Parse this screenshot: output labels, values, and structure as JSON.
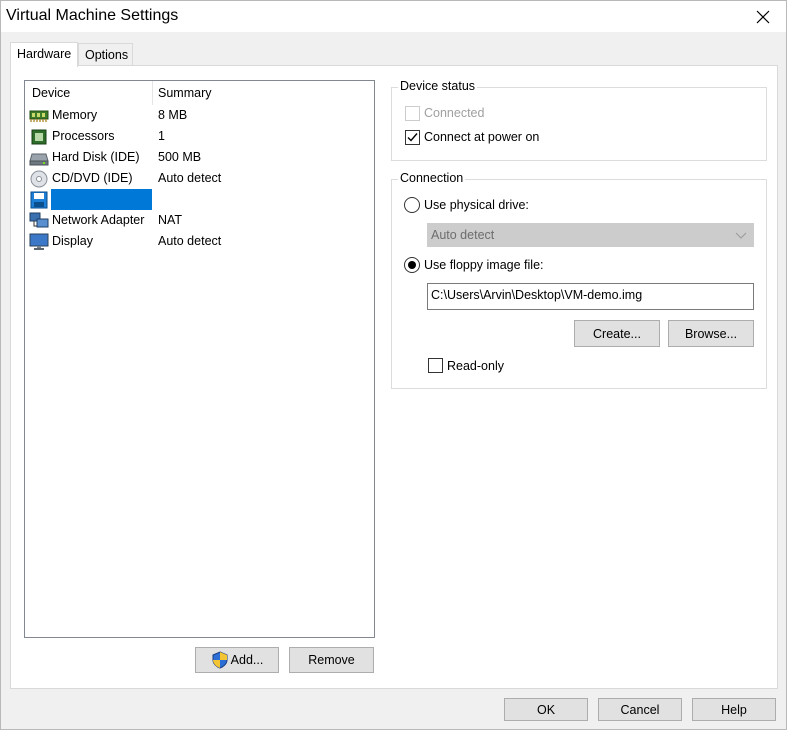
{
  "window": {
    "title": "Virtual Machine Settings"
  },
  "tabs": [
    {
      "label": "Hardware",
      "active": true
    },
    {
      "label": "Options",
      "active": false
    }
  ],
  "device_list": {
    "columns": [
      "Device",
      "Summary"
    ],
    "rows": [
      {
        "device": "Memory",
        "summary": "8 MB",
        "icon": "memory-icon",
        "selected": false
      },
      {
        "device": "Processors",
        "summary": "1",
        "icon": "processor-icon",
        "selected": false
      },
      {
        "device": "Hard Disk (IDE)",
        "summary": "500 MB",
        "icon": "hard-disk-icon",
        "selected": false
      },
      {
        "device": "CD/DVD (IDE)",
        "summary": "Auto detect",
        "icon": "cd-dvd-icon",
        "selected": false
      },
      {
        "device": "",
        "summary": "",
        "icon": "floppy-icon",
        "selected": true
      },
      {
        "device": "Network Adapter",
        "summary": "NAT",
        "icon": "network-adapter-icon",
        "selected": false
      },
      {
        "device": "Display",
        "summary": "Auto detect",
        "icon": "display-icon",
        "selected": false
      }
    ],
    "add_label": "Add...",
    "remove_label": "Remove"
  },
  "device_status": {
    "title": "Device status",
    "connected_label": "Connected",
    "connected_checked": false,
    "connected_enabled": false,
    "connect_power_on_label": "Connect at power on",
    "connect_power_on_checked": true
  },
  "connection": {
    "title": "Connection",
    "physical_drive_label": "Use physical drive:",
    "physical_drive_selected": false,
    "physical_drive_value": "Auto detect",
    "floppy_image_label": "Use floppy image file:",
    "floppy_image_selected": true,
    "floppy_image_path": "C:\\Users\\Arvin\\Desktop\\VM-demo.img",
    "create_label": "Create...",
    "browse_label": "Browse...",
    "read_only_label": "Read-only",
    "read_only_checked": false
  },
  "footer": {
    "ok_label": "OK",
    "cancel_label": "Cancel",
    "help_label": "Help"
  },
  "colors": {
    "selection": "#0078d7",
    "button_face": "#e1e1e1",
    "disabled_field": "#cccccc"
  }
}
